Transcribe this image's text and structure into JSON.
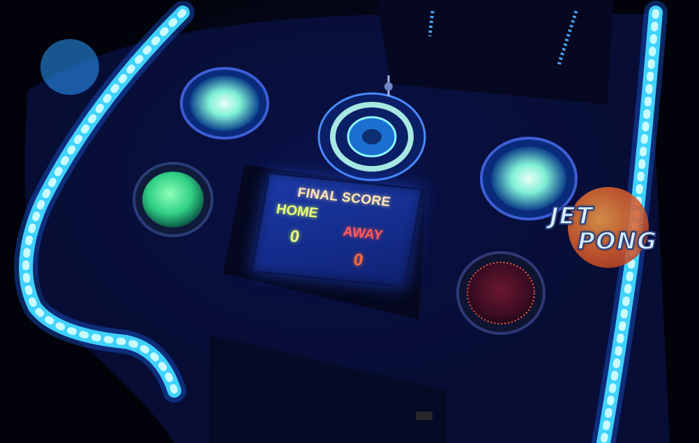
{
  "scoreboard": {
    "title": "FINAL SCORE",
    "home_label": "HOME",
    "away_label": "AWAY",
    "home_score": "0",
    "away_score": "0"
  },
  "logo": {
    "word_1": "JET",
    "word_2": "PONG"
  },
  "colors": {
    "led_strip": "#3fd2ff",
    "cabinet": "#070c2e",
    "home_text": "#e8ff7a",
    "away_text": "#ff5a5a"
  }
}
